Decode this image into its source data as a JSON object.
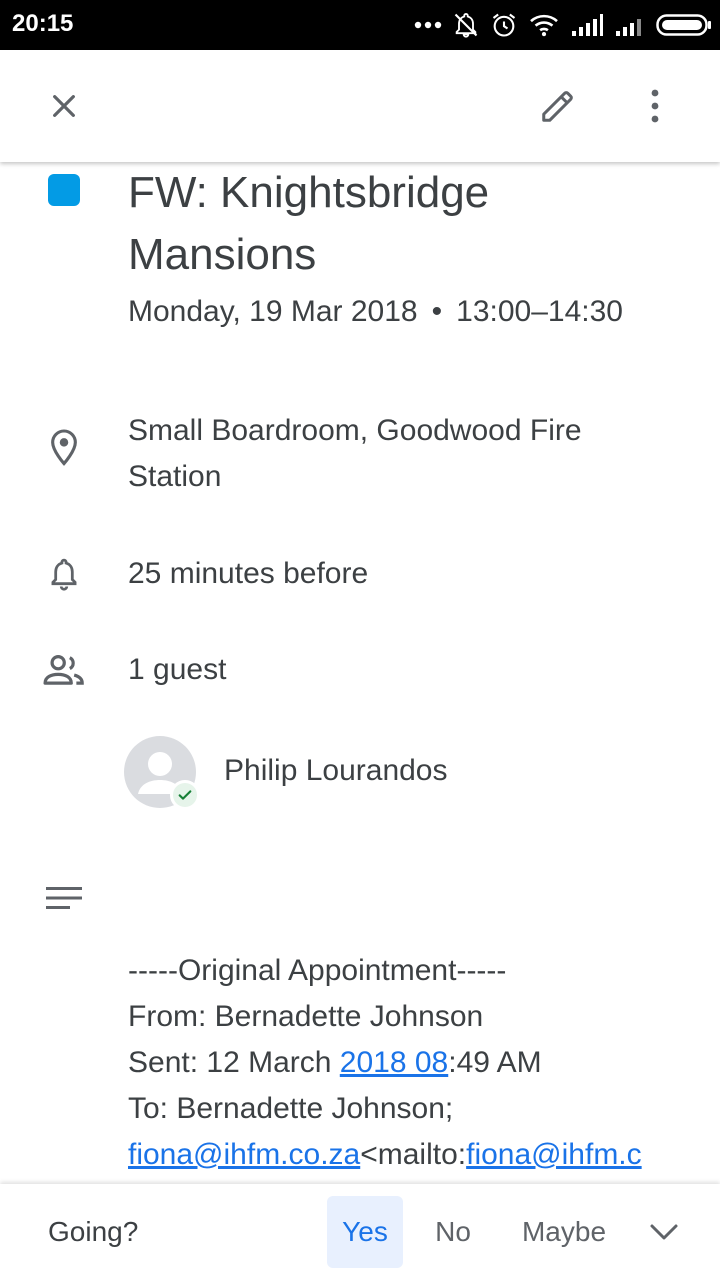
{
  "status_bar": {
    "time": "20:15",
    "icons": [
      "more-dots-icon",
      "bell-off-icon",
      "alarm-icon",
      "wifi-icon",
      "signal-icon",
      "signal-icon-2",
      "battery-icon"
    ]
  },
  "app_bar": {
    "close_icon": "close-icon",
    "edit_icon": "pencil-icon",
    "more_icon": "more-vert-icon"
  },
  "event": {
    "color": "#039be5",
    "title": "FW: Knightsbridge Mansions",
    "date": "Monday, 19 Mar 2018",
    "separator": "•",
    "time_range": "13:00–14:30",
    "location": "Small Boardroom, Goodwood Fire Station",
    "reminder": "25 minutes before",
    "guest_count": "1 guest",
    "guests": [
      {
        "name": "Philip Lourandos",
        "status": "accepted"
      }
    ]
  },
  "description": {
    "line1": "-----Original Appointment-----",
    "line2": "From: Bernadette Johnson",
    "line3_prefix": "Sent: 12 March ",
    "line3_link": "2018 08",
    "line3_suffix": ":49 AM",
    "line4": "To: Bernadette Johnson;",
    "line5_link1": "fiona@ihfm.co.za",
    "line5_mid": "<mailto:",
    "line5_link2": "fiona@ihfm.c"
  },
  "rsvp": {
    "question": "Going?",
    "yes": "Yes",
    "no": "No",
    "maybe": "Maybe",
    "selected": "Yes",
    "accent_color": "#1a73e8"
  }
}
